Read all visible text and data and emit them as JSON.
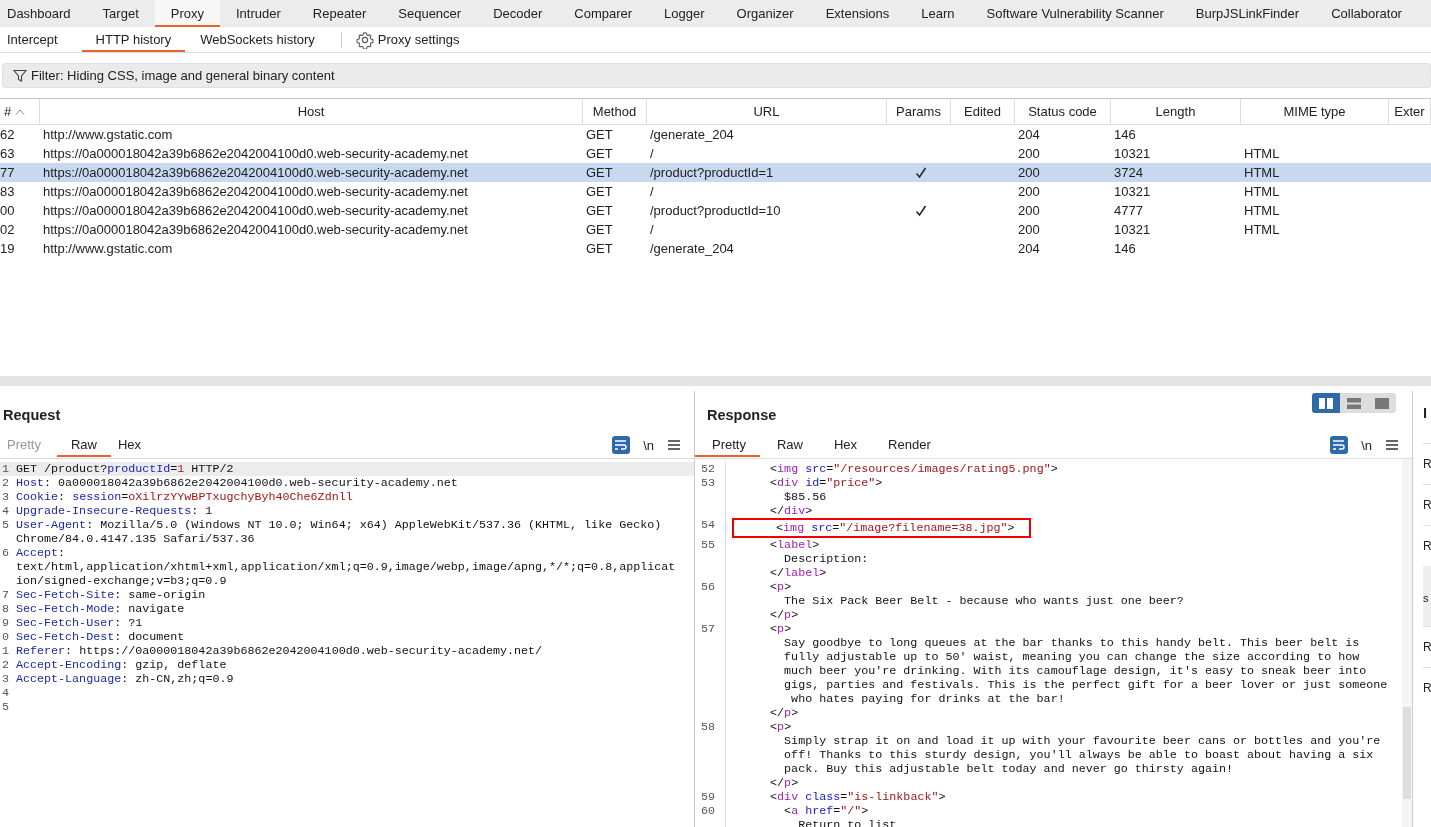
{
  "main_tabs": [
    {
      "label": "Dashboard",
      "selected": false
    },
    {
      "label": "Target",
      "selected": false
    },
    {
      "label": "Proxy",
      "selected": true
    },
    {
      "label": "Intruder",
      "selected": false
    },
    {
      "label": "Repeater",
      "selected": false
    },
    {
      "label": "Sequencer",
      "selected": false
    },
    {
      "label": "Decoder",
      "selected": false
    },
    {
      "label": "Comparer",
      "selected": false
    },
    {
      "label": "Logger",
      "selected": false
    },
    {
      "label": "Organizer",
      "selected": false
    },
    {
      "label": "Extensions",
      "selected": false
    },
    {
      "label": "Learn",
      "selected": false
    },
    {
      "label": "Software Vulnerability Scanner",
      "selected": false
    },
    {
      "label": "BurpJSLinkFinder",
      "selected": false
    },
    {
      "label": "Collaborator",
      "selected": false
    }
  ],
  "sub_tabs": [
    {
      "label": "Intercept",
      "selected": false
    },
    {
      "label": "HTTP history",
      "selected": true
    },
    {
      "label": "WebSockets history",
      "selected": false
    }
  ],
  "settings_button": "Proxy settings",
  "filter": "Filter: Hiding CSS, image and general binary content",
  "table": {
    "columns": [
      "#",
      "Host",
      "Method",
      "URL",
      "Params",
      "Edited",
      "Status code",
      "Length",
      "MIME type",
      "Exter"
    ],
    "rows": [
      {
        "number": "62",
        "host": "http://www.gstatic.com",
        "method": "GET",
        "url": "/generate_204",
        "params": false,
        "status": "204",
        "length": "146",
        "selected": false
      },
      {
        "number": "63",
        "host": "https://0a000018042a39b6862e2042004100d0.web-security-academy.net",
        "method": "GET",
        "url": "/",
        "params": false,
        "status": "200",
        "length": "10321",
        "mime": "HTML",
        "selected": false
      },
      {
        "number": "77",
        "host": "https://0a000018042a39b6862e2042004100d0.web-security-academy.net",
        "method": "GET",
        "url": "/product?productId=1",
        "params": true,
        "status": "200",
        "length": "3724",
        "mime": "HTML",
        "selected": true
      },
      {
        "number": "83",
        "host": "https://0a000018042a39b6862e2042004100d0.web-security-academy.net",
        "method": "GET",
        "url": "/",
        "params": false,
        "status": "200",
        "length": "10321",
        "mime": "HTML",
        "selected": false
      },
      {
        "number": "00",
        "host": "https://0a000018042a39b6862e2042004100d0.web-security-academy.net",
        "method": "GET",
        "url": "/product?productId=10",
        "params": true,
        "status": "200",
        "length": "4777",
        "mime": "HTML",
        "selected": false
      },
      {
        "number": "02",
        "host": "https://0a000018042a39b6862e2042004100d0.web-security-academy.net",
        "method": "GET",
        "url": "/",
        "params": false,
        "status": "200",
        "length": "10321",
        "mime": "HTML",
        "selected": false
      },
      {
        "number": "19",
        "host": "http://www.gstatic.com",
        "method": "GET",
        "url": "/generate_204",
        "params": false,
        "status": "204",
        "length": "146",
        "selected": false
      }
    ]
  },
  "request": {
    "title": "Request",
    "tabs": [
      {
        "label": "Pretty",
        "selected": false,
        "disabled": true
      },
      {
        "label": "Raw",
        "selected": true,
        "disabled": false
      },
      {
        "label": "Hex",
        "selected": false,
        "disabled": false
      }
    ],
    "newline_toggle": "\\n",
    "lines": [
      {
        "n": "1",
        "current": true,
        "s": [
          {
            "kind": "plain",
            "text": "GET /product?"
          },
          {
            "kind": "attr",
            "text": "productId"
          },
          {
            "kind": "plain",
            "text": "="
          },
          {
            "kind": "value",
            "text": "1"
          },
          {
            "kind": "plain",
            "text": " HTTP/2"
          }
        ]
      },
      {
        "n": "2",
        "current": false,
        "s": [
          {
            "kind": "header",
            "text": "Host"
          },
          {
            "kind": "plain",
            "text": ": 0a000018042a39b6862e2042004100d0.web-security-academy.net"
          }
        ]
      },
      {
        "n": "3",
        "current": false,
        "s": [
          {
            "kind": "header",
            "text": "Cookie"
          },
          {
            "kind": "plain",
            "text": ": "
          },
          {
            "kind": "attr",
            "text": "session"
          },
          {
            "kind": "plain",
            "text": "="
          },
          {
            "kind": "value",
            "text": "oXilrzYYwBPTxugchyByh40Che6Zdnll"
          }
        ]
      },
      {
        "n": "4",
        "current": false,
        "s": [
          {
            "kind": "header",
            "text": "Upgrade-Insecure-Requests"
          },
          {
            "kind": "plain",
            "text": ": 1"
          }
        ]
      },
      {
        "n": "5",
        "current": false,
        "s": [
          {
            "kind": "header",
            "text": "User-Agent"
          },
          {
            "kind": "plain",
            "text": ": Mozilla/5.0 (Windows NT 10.0; Win64; x64) AppleWebKit/537.36 (KHTML, like Gecko)"
          }
        ]
      },
      {
        "current": false,
        "s": [
          {
            "kind": "plain",
            "text": "Chrome/84.0.4147.135 Safari/537.36"
          }
        ]
      },
      {
        "n": "6",
        "current": false,
        "s": [
          {
            "kind": "header",
            "text": "Accept"
          },
          {
            "kind": "plain",
            "text": ":"
          }
        ]
      },
      {
        "current": false,
        "s": [
          {
            "kind": "plain",
            "text": "text/html,application/xhtml+xml,application/xml;q=0.9,image/webp,image/apng,*/*;q=0.8,applicat"
          }
        ]
      },
      {
        "current": false,
        "s": [
          {
            "kind": "plain",
            "text": "ion/signed-exchange;v=b3;q=0.9"
          }
        ]
      },
      {
        "n": "7",
        "current": false,
        "s": [
          {
            "kind": "header",
            "text": "Sec-Fetch-Site"
          },
          {
            "kind": "plain",
            "text": ": same-origin"
          }
        ]
      },
      {
        "n": "8",
        "current": false,
        "s": [
          {
            "kind": "header",
            "text": "Sec-Fetch-Mode"
          },
          {
            "kind": "plain",
            "text": ": navigate"
          }
        ]
      },
      {
        "n": "9",
        "current": false,
        "s": [
          {
            "kind": "header",
            "text": "Sec-Fetch-User"
          },
          {
            "kind": "plain",
            "text": ": ?1"
          }
        ]
      },
      {
        "n": "0",
        "current": false,
        "s": [
          {
            "kind": "header",
            "text": "Sec-Fetch-Dest"
          },
          {
            "kind": "plain",
            "text": ": document"
          }
        ]
      },
      {
        "n": "1",
        "current": false,
        "s": [
          {
            "kind": "header",
            "text": "Referer"
          },
          {
            "kind": "plain",
            "text": ": https://0a000018042a39b6862e2042004100d0.web-security-academy.net/"
          }
        ]
      },
      {
        "n": "2",
        "current": false,
        "s": [
          {
            "kind": "header",
            "text": "Accept-Encoding"
          },
          {
            "kind": "plain",
            "text": ": gzip, deflate"
          }
        ]
      },
      {
        "n": "3",
        "current": false,
        "s": [
          {
            "kind": "header",
            "text": "Accept-Language"
          },
          {
            "kind": "plain",
            "text": ": zh-CN,zh;q=0.9"
          }
        ]
      },
      {
        "n": "4",
        "current": false
      },
      {
        "n": "5",
        "current": false
      }
    ]
  },
  "response": {
    "title": "Response",
    "layout_buttons": [
      {
        "kind": "columns",
        "selected": true
      },
      {
        "kind": "rows",
        "selected": false
      },
      {
        "kind": "single",
        "selected": false
      }
    ],
    "tabs": [
      {
        "label": "Pretty",
        "selected": true,
        "disabled": false
      },
      {
        "label": "Raw",
        "selected": false,
        "disabled": false
      },
      {
        "label": "Hex",
        "selected": false,
        "disabled": false
      },
      {
        "label": "Render",
        "selected": false,
        "disabled": false
      }
    ],
    "newline_toggle": "\\n",
    "lines": [
      {
        "n": "52",
        "highlighted": false,
        "s": [
          {
            "kind": "plain",
            "text": "      <"
          },
          {
            "kind": "tag",
            "text": "img"
          },
          {
            "kind": "attr",
            "text": " src"
          },
          {
            "kind": "plain",
            "text": "="
          },
          {
            "kind": "value",
            "text": "\"/resources/images/rating5.png\""
          },
          {
            "kind": "plain",
            "text": ">"
          }
        ]
      },
      {
        "n": "53",
        "highlighted": false,
        "s": [
          {
            "kind": "plain",
            "text": "      <"
          },
          {
            "kind": "tag",
            "text": "div"
          },
          {
            "kind": "attr",
            "text": " id"
          },
          {
            "kind": "plain",
            "text": "="
          },
          {
            "kind": "value",
            "text": "\"price\""
          },
          {
            "kind": "plain",
            "text": ">"
          }
        ]
      },
      {
        "highlighted": false,
        "s": [
          {
            "kind": "plain",
            "text": "        $85.56"
          }
        ]
      },
      {
        "highlighted": false,
        "s": [
          {
            "kind": "plain",
            "text": "      </"
          },
          {
            "kind": "tag",
            "text": "div"
          },
          {
            "kind": "plain",
            "text": ">"
          }
        ]
      },
      {
        "n": "54",
        "highlighted": true,
        "s": [
          {
            "kind": "plain",
            "text": "      <"
          },
          {
            "kind": "tag",
            "text": "img"
          },
          {
            "kind": "attr",
            "text": " src"
          },
          {
            "kind": "plain",
            "text": "="
          },
          {
            "kind": "value",
            "text": "\"/image?filename=38.jpg\""
          },
          {
            "kind": "plain",
            "text": ">"
          }
        ]
      },
      {
        "n": "55",
        "highlighted": false,
        "s": [
          {
            "kind": "plain",
            "text": "      <"
          },
          {
            "kind": "tag",
            "text": "label"
          },
          {
            "kind": "plain",
            "text": ">"
          }
        ]
      },
      {
        "highlighted": false,
        "s": [
          {
            "kind": "plain",
            "text": "        Description:"
          }
        ]
      },
      {
        "highlighted": false,
        "s": [
          {
            "kind": "plain",
            "text": "      </"
          },
          {
            "kind": "tag",
            "text": "label"
          },
          {
            "kind": "plain",
            "text": ">"
          }
        ]
      },
      {
        "n": "56",
        "highlighted": false,
        "s": [
          {
            "kind": "plain",
            "text": "      <"
          },
          {
            "kind": "tag",
            "text": "p"
          },
          {
            "kind": "plain",
            "text": ">"
          }
        ]
      },
      {
        "highlighted": false,
        "s": [
          {
            "kind": "plain",
            "text": "        The Six Pack Beer Belt - because who wants just one beer?"
          }
        ]
      },
      {
        "highlighted": false,
        "s": [
          {
            "kind": "plain",
            "text": "      </"
          },
          {
            "kind": "tag",
            "text": "p"
          },
          {
            "kind": "plain",
            "text": ">"
          }
        ]
      },
      {
        "n": "57",
        "highlighted": false,
        "s": [
          {
            "kind": "plain",
            "text": "      <"
          },
          {
            "kind": "tag",
            "text": "p"
          },
          {
            "kind": "plain",
            "text": ">"
          }
        ]
      },
      {
        "highlighted": false,
        "s": [
          {
            "kind": "plain",
            "text": "        Say goodbye to long queues at the bar thanks to this handy belt. This beer belt is"
          }
        ]
      },
      {
        "highlighted": false,
        "s": [
          {
            "kind": "plain",
            "text": "        fully adjustable up to 50' waist, meaning you can change the size according to how"
          }
        ]
      },
      {
        "highlighted": false,
        "s": [
          {
            "kind": "plain",
            "text": "        much beer you're drinking. With its camouflage design, it's easy to sneak beer into"
          }
        ]
      },
      {
        "highlighted": false,
        "s": [
          {
            "kind": "plain",
            "text": "        gigs, parties and festivals. This is the perfect gift for a beer lover or just someone"
          }
        ]
      },
      {
        "highlighted": false,
        "s": [
          {
            "kind": "plain",
            "text": "         who hates paying for drinks at the bar!"
          }
        ]
      },
      {
        "highlighted": false,
        "s": [
          {
            "kind": "plain",
            "text": "      </"
          },
          {
            "kind": "tag",
            "text": "p"
          },
          {
            "kind": "plain",
            "text": ">"
          }
        ]
      },
      {
        "n": "58",
        "highlighted": false,
        "s": [
          {
            "kind": "plain",
            "text": "      <"
          },
          {
            "kind": "tag",
            "text": "p"
          },
          {
            "kind": "plain",
            "text": ">"
          }
        ]
      },
      {
        "highlighted": false,
        "s": [
          {
            "kind": "plain",
            "text": "        Simply strap it on and load it up with your favourite beer cans or bottles and you're"
          }
        ]
      },
      {
        "highlighted": false,
        "s": [
          {
            "kind": "plain",
            "text": "        off! Thanks to this sturdy design, you'll always be able to boast about having a six"
          }
        ]
      },
      {
        "highlighted": false,
        "s": [
          {
            "kind": "plain",
            "text": "        pack. Buy this adjustable belt today and never go thirsty again!"
          }
        ]
      },
      {
        "highlighted": false,
        "s": [
          {
            "kind": "plain",
            "text": "      </"
          },
          {
            "kind": "tag",
            "text": "p"
          },
          {
            "kind": "plain",
            "text": ">"
          }
        ]
      },
      {
        "n": "59",
        "highlighted": false,
        "s": [
          {
            "kind": "plain",
            "text": "      <"
          },
          {
            "kind": "tag",
            "text": "div"
          },
          {
            "kind": "attr",
            "text": " class"
          },
          {
            "kind": "plain",
            "text": "="
          },
          {
            "kind": "value",
            "text": "\"is-linkback\""
          },
          {
            "kind": "plain",
            "text": ">"
          }
        ]
      },
      {
        "n": "60",
        "highlighted": false,
        "s": [
          {
            "kind": "plain",
            "text": "        <"
          },
          {
            "kind": "tag",
            "text": "a"
          },
          {
            "kind": "attr",
            "text": " href"
          },
          {
            "kind": "plain",
            "text": "="
          },
          {
            "kind": "value",
            "text": "\"/\""
          },
          {
            "kind": "plain",
            "text": ">"
          }
        ]
      },
      {
        "highlighted": false,
        "s": [
          {
            "kind": "plain",
            "text": "          Return to list"
          }
        ]
      }
    ]
  },
  "inspector": {
    "title": "I",
    "rows": [
      {
        "kind": "row",
        "text": "R"
      },
      {
        "kind": "row",
        "text": "R"
      },
      {
        "kind": "row",
        "text": "R"
      },
      {
        "kind": "box",
        "text": "s"
      },
      {
        "kind": "row",
        "text": "R"
      },
      {
        "kind": "row",
        "text": "R"
      }
    ]
  }
}
